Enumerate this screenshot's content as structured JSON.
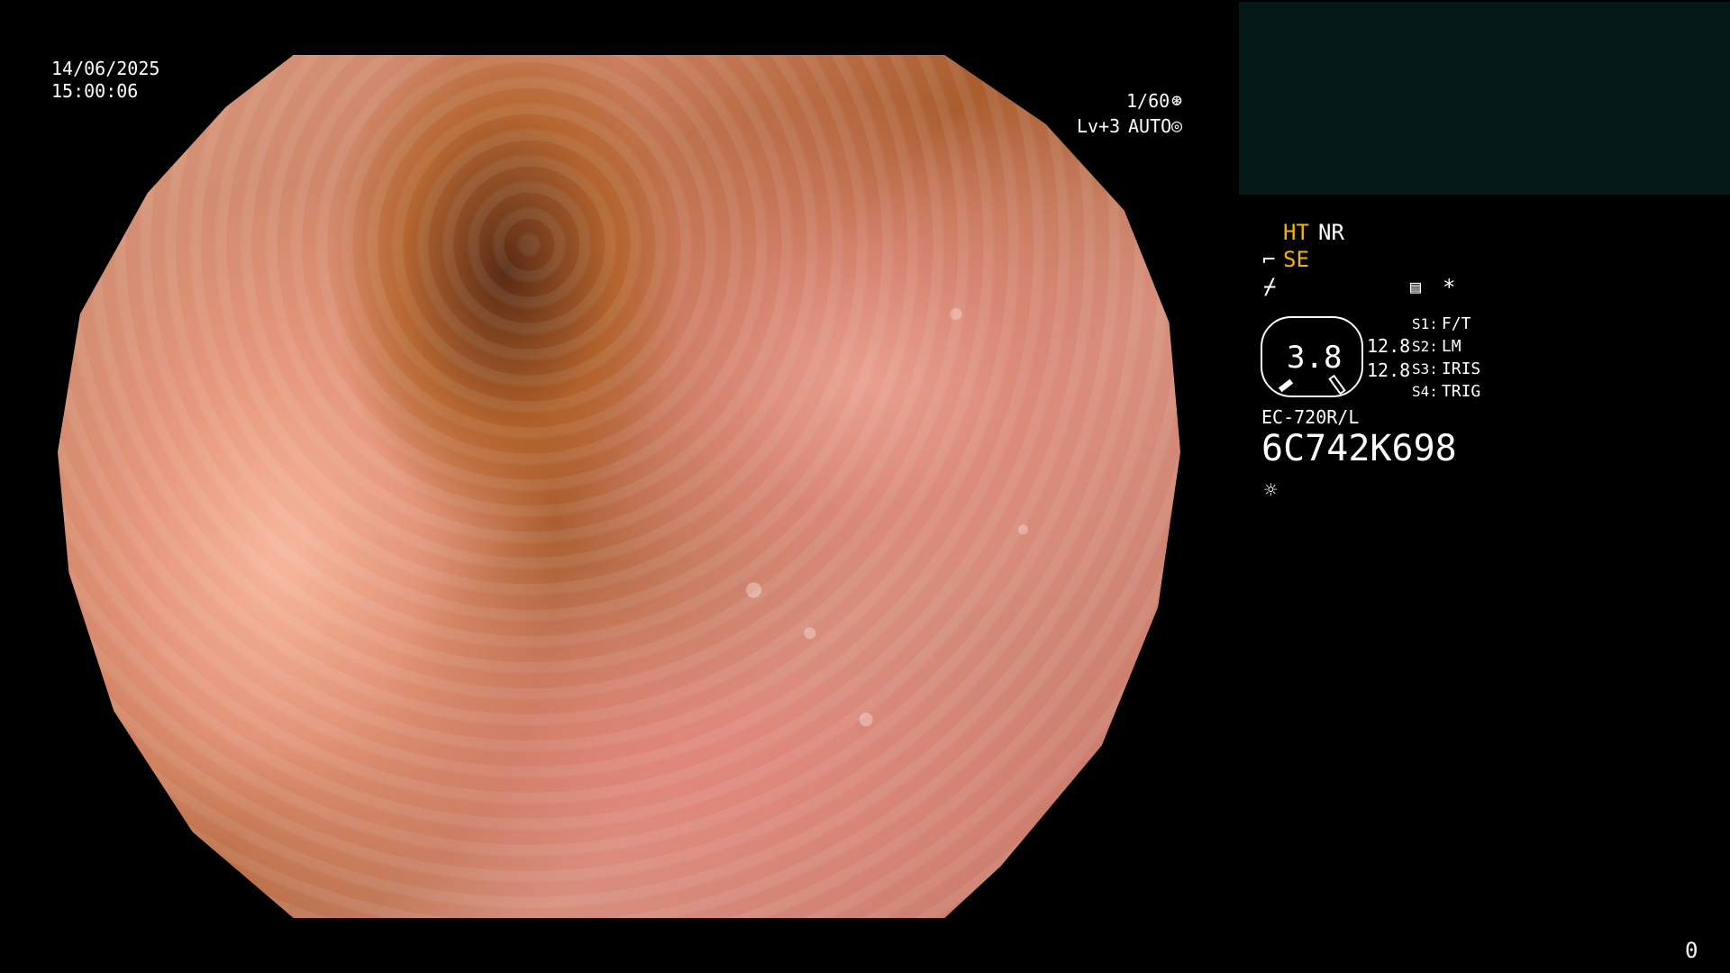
{
  "overlay": {
    "date": "14/06/2025",
    "time": "15:00:06",
    "shutter": "1/60",
    "shutter_icon": "aperture-icon",
    "level": "Lv+3",
    "exposure_mode": "AUTO",
    "exposure_icon": "gear-icon",
    "frame_count": "0"
  },
  "side_panel": {
    "ht_label": "HT",
    "nr_label": "NR",
    "se_label": "SE",
    "dial_value": "3.8",
    "left_readout_top": "12.8",
    "left_readout_bottom": "12.8",
    "s1_key": "S1:",
    "s1_value": "F/T",
    "s2_key": "S2:",
    "s2_value": "LM",
    "s3_key": "S3:",
    "s3_value": "IRIS",
    "s4_key": "S4:",
    "s4_value": "TRIG",
    "scope_model": "EC-720R/L",
    "serial": "6C742K698",
    "menu_icon": "menu-grid-icon",
    "asterisk": "*",
    "light_icon": "sun-icon",
    "arrow_icon": "hand-pointer-icon",
    "noise_icon": "slash-icon"
  },
  "colors": {
    "background": "#000000",
    "text": "#ffffff",
    "accent": "#f4b400",
    "monitor_box": "#041a19"
  }
}
